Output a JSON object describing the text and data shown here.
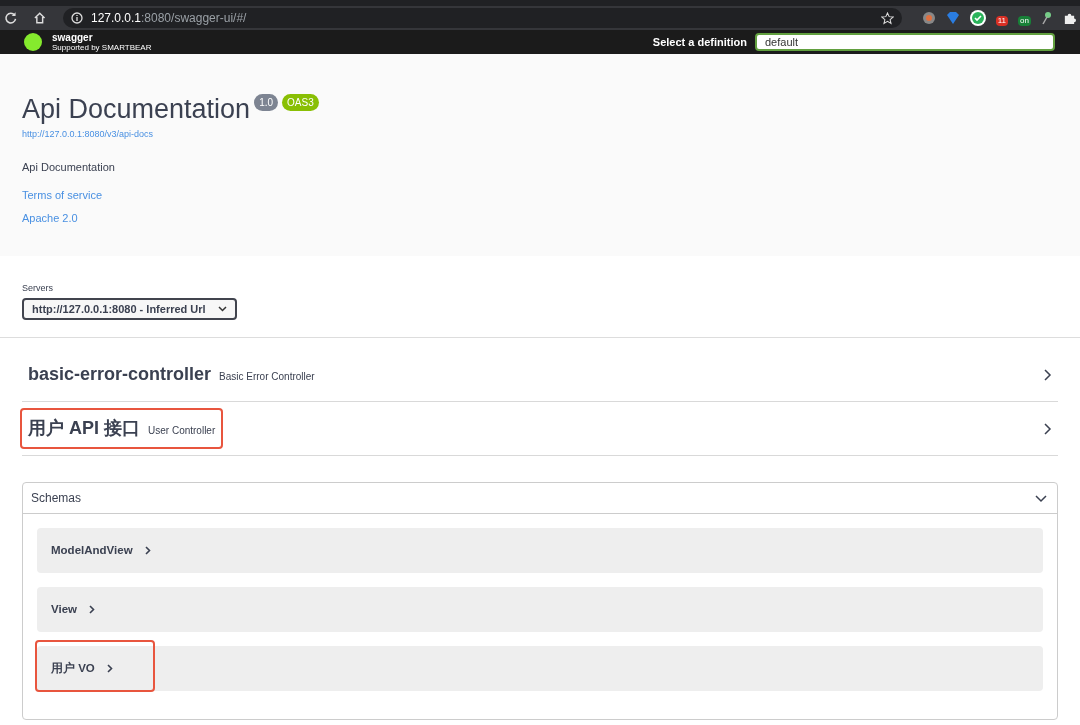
{
  "browser": {
    "address": {
      "host": "127.0.0.1",
      "path": ":8080/swagger-ui/#/"
    },
    "extension_badges": [
      "11",
      "on"
    ]
  },
  "topbar": {
    "logo_text": "swagger",
    "tagline": "Supported by SMARTBEAR",
    "definition_label": "Select a definition",
    "definition_value": "default"
  },
  "info": {
    "title": "Api Documentation",
    "version": "1.0",
    "spec": "OAS3",
    "url": "http://127.0.0.1:8080/v3/api-docs",
    "description": "Api Documentation",
    "links": [
      "Terms of service",
      "Apache 2.0"
    ]
  },
  "servers": {
    "label": "Servers",
    "value": "http://127.0.0.1:8080 - Inferred Url"
  },
  "tags": [
    {
      "name": "basic-error-controller",
      "description": "Basic Error Controller",
      "expanded": false,
      "highlighted": false
    },
    {
      "name": "用户 API 接口",
      "description": "User Controller",
      "expanded": false,
      "highlighted": true
    }
  ],
  "schemas": {
    "title": "Schemas",
    "expanded": true,
    "models": [
      {
        "name": "ModelAndView",
        "highlighted": false
      },
      {
        "name": "View",
        "highlighted": false
      },
      {
        "name": "用户 VO",
        "highlighted": true
      }
    ]
  }
}
